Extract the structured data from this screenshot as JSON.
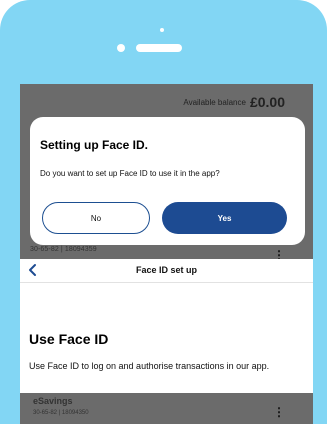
{
  "balance": {
    "label": "Available balance",
    "value": "£0.00"
  },
  "dialog": {
    "title": "Setting up Face ID.",
    "message": "Do you want to set up Face ID to use it in the app?",
    "no_label": "No",
    "yes_label": "Yes"
  },
  "accounts": {
    "top_detail": "30-65-82 | 18094359",
    "bottom_name": "eSavings",
    "bottom_detail": "30-65-82 | 18094350"
  },
  "panel": {
    "title": "Face ID set up",
    "heading": "Use Face ID",
    "body": "Use Face ID to log on and authorise transactions in our app."
  },
  "colors": {
    "phone_frame": "#82d6f4",
    "primary_button": "#1d4b92",
    "overlay": "#6b6b6b"
  }
}
